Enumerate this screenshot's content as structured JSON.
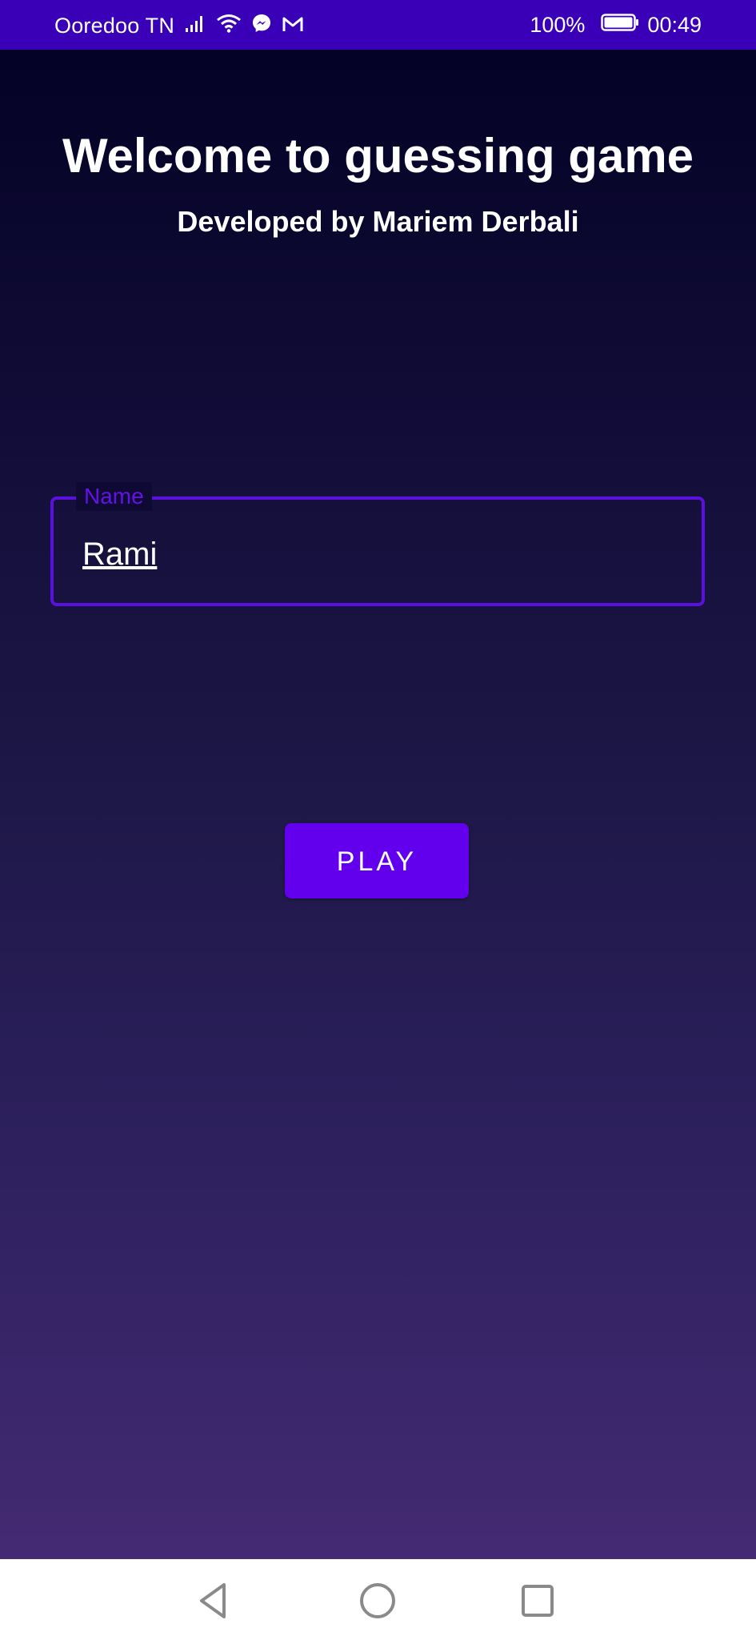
{
  "status_bar": {
    "carrier": "Ooredoo TN",
    "battery": "100%",
    "time": "00:49",
    "icons": [
      "signal-icon",
      "wifi-icon",
      "messenger-icon",
      "gmail-icon",
      "battery-icon"
    ]
  },
  "app": {
    "title": "Welcome to guessing game",
    "subtitle": "Developed by Mariem Derbali",
    "name_field": {
      "label": "Name",
      "value": "Rami"
    },
    "play_button": "PLAY"
  },
  "nav_bar": {
    "icons": [
      "back-icon",
      "home-icon",
      "recent-apps-icon"
    ]
  },
  "colors": {
    "status_bar": "#3a00b8",
    "accent": "#6200ee",
    "field_border": "#5c10e0",
    "background_top": "#040226",
    "background_bottom": "#442a72"
  }
}
